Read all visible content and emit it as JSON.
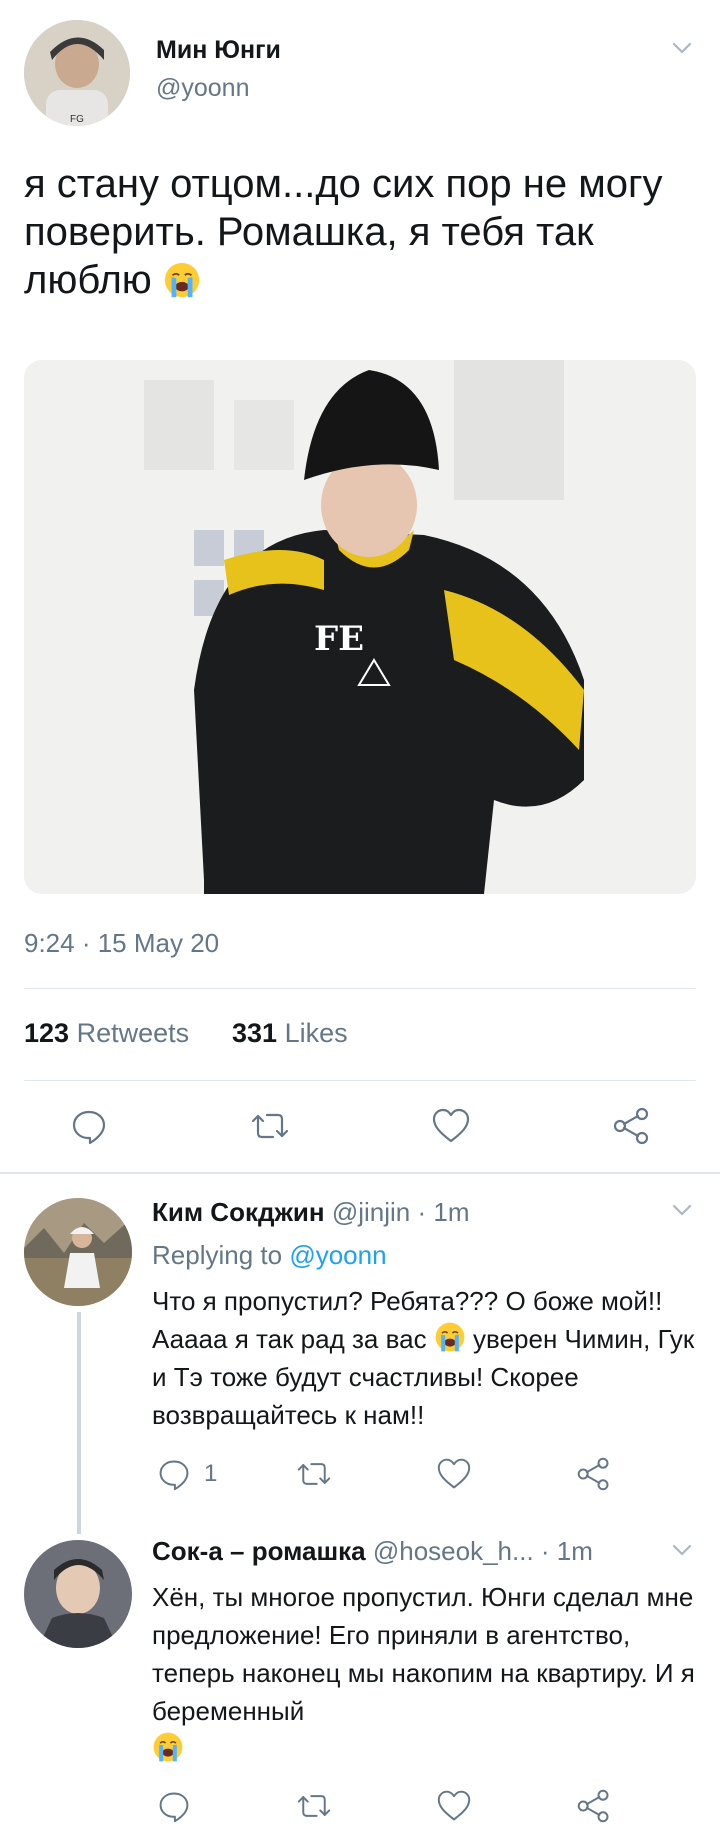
{
  "tweet": {
    "author_name": "Мин Юнги",
    "author_handle": "@yoonn",
    "text_main": "я стану отцом...до сих пор не могу поверить. Ромашка, я тебя так люблю",
    "emoji": "loudly-crying-face",
    "time": "9:24 · 15 May 20",
    "retweets_count": "123",
    "retweets_label": "Retweets",
    "likes_count": "331",
    "likes_label": "Likes"
  },
  "replies": [
    {
      "author_name": "Ким Сокджин",
      "author_handle": "@jinjin",
      "time": "· 1m",
      "replying_label": "Replying to",
      "replying_handle": "@yoonn",
      "text_1": "Что я пропустил? Ребята??? О боже мой!! Ааааа я так рад за вас",
      "text_2": "уверен Чимин, Гук и Тэ тоже будут счастливы! Скорее возвращайтесь к нам!!",
      "reply_count": "1"
    },
    {
      "author_name": "Сок-а – ромашка",
      "author_handle": "@hoseok_h...",
      "time": "· 1m",
      "text_1": "Хён, ты многое пропустил. Юнги сделал мне предложение! Его приняли в агентство, теперь наконец мы накопим на квартиру. И я беременный"
    }
  ],
  "icons": [
    "reply-icon",
    "retweet-icon",
    "like-icon",
    "share-icon",
    "chevron-down-icon",
    "loudly-crying-face-emoji"
  ],
  "colors": {
    "link": "#1da1f2",
    "muted": "#657786",
    "divider": "#e1e8ed",
    "text": "#14171a"
  }
}
